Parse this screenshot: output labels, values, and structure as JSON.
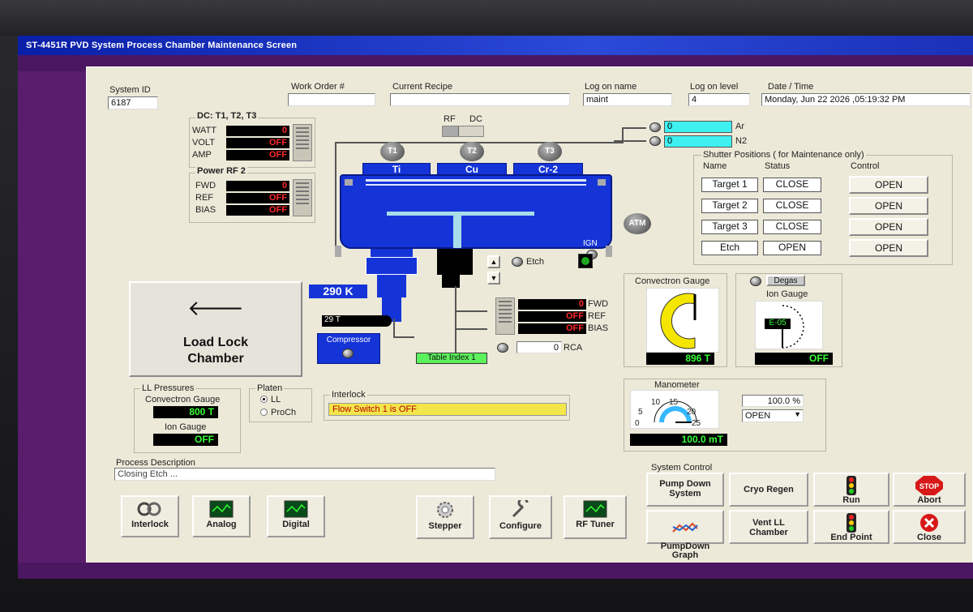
{
  "window_title": "ST-4451R PVD System Process Chamber Maintenance Screen",
  "header": {
    "system_id_label": "System ID",
    "system_id": "6187",
    "work_order_label": "Work Order #",
    "work_order": "",
    "current_recipe_label": "Current Recipe",
    "current_recipe": "",
    "log_on_name_label": "Log on name",
    "log_on_name": "maint",
    "log_on_level_label": "Log on level",
    "log_on_level": "4",
    "date_time_label": "Date / Time",
    "date_time": "Monday, Jun 22 2026 ,05:19:32 PM"
  },
  "dc_panel": {
    "title": "DC: T1, T2, T3",
    "rows": [
      {
        "label": "WATT",
        "value": "0"
      },
      {
        "label": "VOLT",
        "value": "OFF"
      },
      {
        "label": "AMP",
        "value": "OFF"
      }
    ]
  },
  "rf2_panel": {
    "title": "Power RF 2",
    "rows": [
      {
        "label": "FWD",
        "value": "0"
      },
      {
        "label": "REF",
        "value": "OFF"
      },
      {
        "label": "BIAS",
        "value": "OFF"
      }
    ]
  },
  "rf_dc_switch": {
    "rf": "RF",
    "dc": "DC"
  },
  "gas": [
    {
      "value": "0",
      "label": "Ar"
    },
    {
      "value": "0",
      "label": "N2"
    }
  ],
  "chamber": {
    "targets": [
      {
        "knob": "T1",
        "name": "Ti"
      },
      {
        "knob": "T2",
        "name": "Cu"
      },
      {
        "knob": "T3",
        "name": "Cr-2"
      }
    ],
    "atm": "ATM",
    "ign": "IGN",
    "temperature": "290 K",
    "pressure_29t": "29 T",
    "compressor": "Compressor",
    "table_index": "Table Index 1",
    "etch_label": "Etch"
  },
  "etch_rf": {
    "rows": [
      {
        "label": "FWD",
        "value": "0"
      },
      {
        "label": "REF",
        "value": "OFF"
      },
      {
        "label": "BIAS",
        "value": "OFF"
      }
    ],
    "rca_value": "0",
    "rca_label": "RCA"
  },
  "shutter": {
    "title": "Shutter Positions ( for Maintenance only)",
    "col_name": "Name",
    "col_status": "Status",
    "col_control": "Control",
    "rows": [
      {
        "name": "Target 1",
        "status": "CLOSE",
        "control": "OPEN"
      },
      {
        "name": "Target 2",
        "status": "CLOSE",
        "control": "OPEN"
      },
      {
        "name": "Target 3",
        "status": "CLOSE",
        "control": "OPEN"
      },
      {
        "name": "Etch",
        "status": "OPEN",
        "control": "OPEN"
      }
    ]
  },
  "load_lock": {
    "line1": "Load Lock",
    "line2": "Chamber",
    "arrow": "arrow-left-icon"
  },
  "ll_pressures": {
    "title": "LL Pressures",
    "convectron_label": "Convectron Gauge",
    "convectron_value": "800 T",
    "ion_label": "Ion Gauge",
    "ion_value": "OFF"
  },
  "platen": {
    "title": "Platen",
    "options": [
      "LL",
      "ProCh"
    ],
    "selected": "LL"
  },
  "interlock": {
    "title": "Interlock",
    "message": "Flow Switch 1 is OFF"
  },
  "convectron_gauge": {
    "title": "Convectron Gauge",
    "value": "896 T",
    "fill_fraction": 0.55
  },
  "ion_gauge": {
    "degas": "Degas",
    "title": "Ion Gauge",
    "reading": "E-05",
    "value": "OFF"
  },
  "manometer": {
    "title": "Manometer",
    "ticks": [
      "0",
      "5",
      "10",
      "15",
      "20",
      "25"
    ],
    "value": "100.0 mT",
    "percent": "100.0 %",
    "valve_state": "OPEN"
  },
  "process": {
    "label": "Process Description",
    "value": "Closing Etch ..."
  },
  "toolbar": [
    {
      "label": "Interlock",
      "icon": "interlock-icon"
    },
    {
      "label": "Analog",
      "icon": "analog-icon"
    },
    {
      "label": "Digital",
      "icon": "digital-icon"
    },
    {
      "label": "Stepper",
      "icon": "gear-icon"
    },
    {
      "label": "Configure",
      "icon": "wrench-icon"
    },
    {
      "label": "RF Tuner",
      "icon": "rf-tuner-icon"
    }
  ],
  "system_control": {
    "title": "System Control",
    "buttons": [
      {
        "label": "Pump Down\nSystem"
      },
      {
        "label": "Cryo Regen"
      },
      {
        "label": "Run",
        "icon": "traffic-light-icon"
      },
      {
        "label": "Abort",
        "icon": "stop-sign-icon",
        "sign": "STOP"
      },
      {
        "label": "PumpDown\nGraph",
        "icon": "graph-icon"
      },
      {
        "label": "Vent LL\nChamber"
      },
      {
        "label": "End Point",
        "icon": "traffic-light-icon"
      },
      {
        "label": "Close",
        "icon": "close-icon"
      }
    ]
  },
  "colors": {
    "chamber_blue": "#1534d8",
    "window_purple": "#5a1d6e",
    "panel_bg": "#ece9d8"
  }
}
